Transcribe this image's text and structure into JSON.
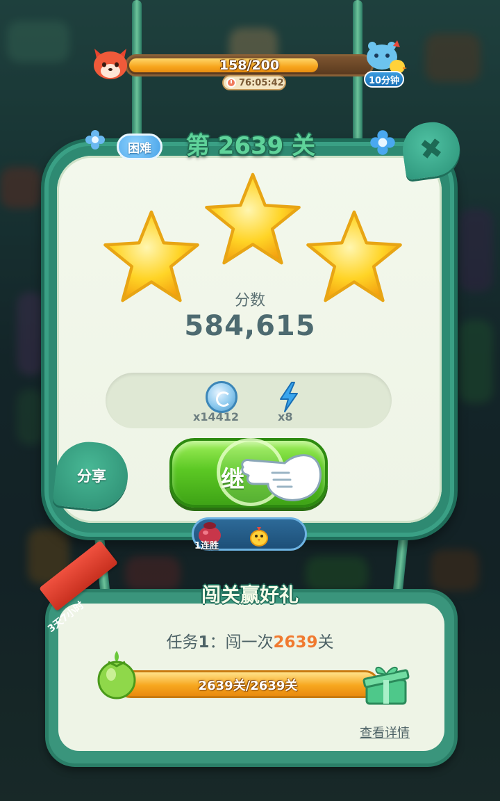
{
  "topbar": {
    "progress_text": "158/200",
    "progress_fraction": 0.79,
    "countdown": "76:05:42",
    "bonus_time": "10分钟"
  },
  "level": {
    "difficulty": "困难",
    "title": "第 2639 关",
    "stars_earned": 3
  },
  "score": {
    "label": "分数",
    "value": "584,615"
  },
  "rewards": {
    "coins": "x14412",
    "energy": "x8"
  },
  "actions": {
    "share_label": "分享",
    "continue_label": "继"
  },
  "streak": {
    "label": "1连胜"
  },
  "task": {
    "card_title": "闯关赢好礼",
    "timer_ribbon": "3天7小时",
    "desc_prefix": "任务",
    "desc_num": "1",
    "desc_sep": "：闯一次",
    "desc_level": "2639",
    "desc_suffix": "关",
    "progress_text": "2639关/2639关",
    "progress_fraction": 1.0,
    "detail_link": "查看详情"
  },
  "colors": {
    "accent_green": "#5fd39a",
    "panel_teal": "#2e8a72",
    "highlight_orange": "#f07a30",
    "progress_gold": "#f7a51d"
  },
  "icons": [
    "fox-avatar-icon",
    "clock-icon",
    "blue-creature-icon",
    "close-icon",
    "star-icon",
    "coin-icon",
    "lightning-icon",
    "pointing-hand-icon",
    "streak-bag-icon",
    "chick-icon",
    "fruit-icon",
    "gift-box-icon",
    "flower-icon"
  ]
}
